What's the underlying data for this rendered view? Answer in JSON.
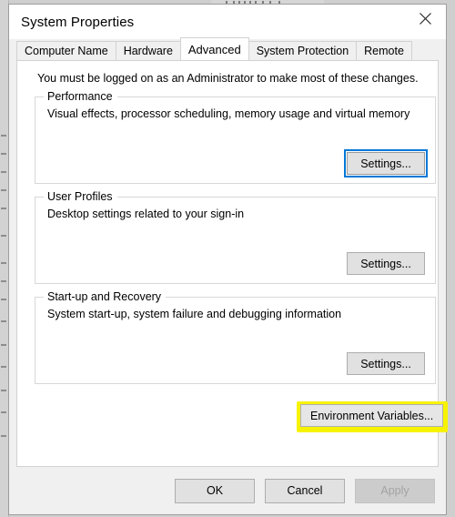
{
  "window": {
    "title": "System Properties",
    "close_icon": "close-icon"
  },
  "tabs": [
    {
      "label": "Computer Name",
      "active": false
    },
    {
      "label": "Hardware",
      "active": false
    },
    {
      "label": "Advanced",
      "active": true
    },
    {
      "label": "System Protection",
      "active": false
    },
    {
      "label": "Remote",
      "active": false
    }
  ],
  "page": {
    "admin_note": "You must be logged on as an Administrator to make most of these changes.",
    "groups": [
      {
        "legend": "Performance",
        "description": "Visual effects, processor scheduling, memory usage and virtual memory",
        "button_label": "Settings...",
        "focused": true
      },
      {
        "legend": "User Profiles",
        "description": "Desktop settings related to your sign-in",
        "button_label": "Settings...",
        "focused": false
      },
      {
        "legend": "Start-up and Recovery",
        "description": "System start-up, system failure and debugging information",
        "button_label": "Settings...",
        "focused": false
      }
    ],
    "environment_variables_button": "Environment Variables...",
    "highlight_color": "#f7f300",
    "focus_color": "#0078d7"
  },
  "footer": {
    "ok_label": "OK",
    "cancel_label": "Cancel",
    "apply_label": "Apply",
    "apply_disabled": true
  }
}
